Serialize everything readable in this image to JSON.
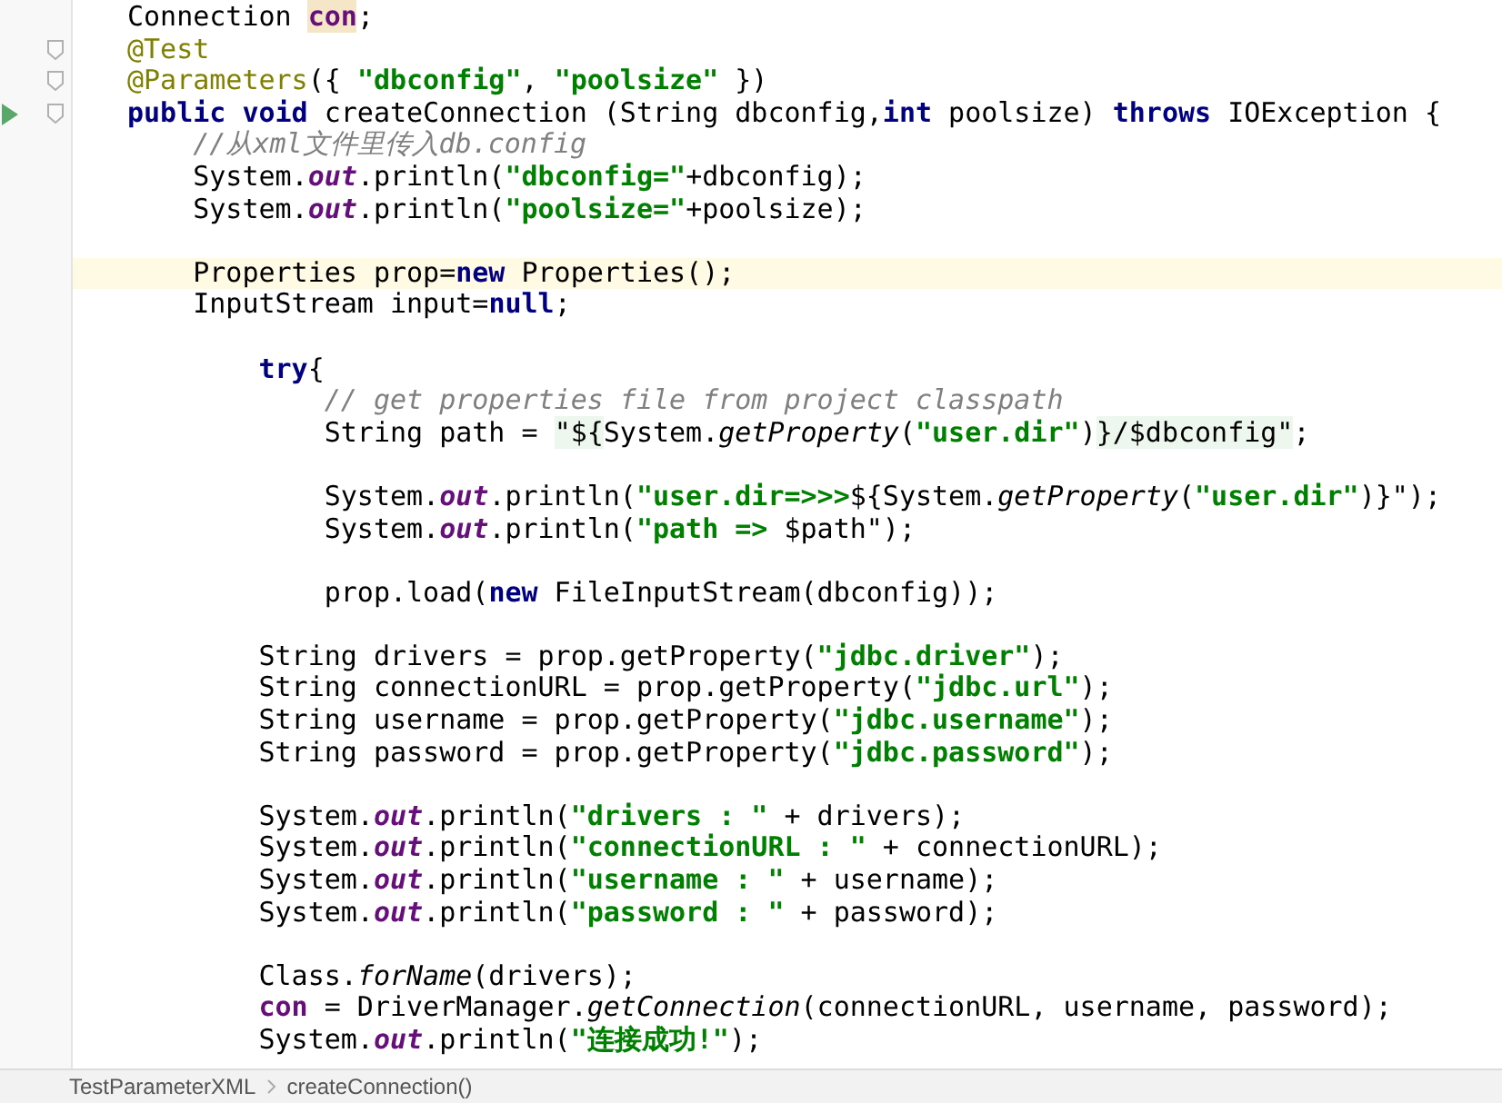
{
  "editor": {
    "lines": [
      {
        "current": false,
        "fold_marker": false,
        "run_marker": false,
        "tokens": [
          {
            "text": "Connection ",
            "kind": "plain"
          },
          {
            "text": "con",
            "kind": "usage"
          },
          {
            "text": ";",
            "kind": "plain"
          }
        ]
      },
      {
        "current": false,
        "fold_marker": true,
        "run_marker": false,
        "tokens": [
          {
            "text": "@Test",
            "kind": "annotation"
          }
        ]
      },
      {
        "current": false,
        "fold_marker": true,
        "run_marker": false,
        "tokens": [
          {
            "text": "@Parameters",
            "kind": "annotation"
          },
          {
            "text": "({ ",
            "kind": "plain"
          },
          {
            "text": "\"dbconfig\"",
            "kind": "string"
          },
          {
            "text": ", ",
            "kind": "plain"
          },
          {
            "text": "\"poolsize\"",
            "kind": "string"
          },
          {
            "text": " })",
            "kind": "plain"
          }
        ]
      },
      {
        "current": false,
        "fold_marker": true,
        "run_marker": true,
        "tokens": [
          {
            "text": "public void",
            "kind": "keyword"
          },
          {
            "text": " createConnection (String dbconfig,",
            "kind": "plain"
          },
          {
            "text": "int",
            "kind": "keyword"
          },
          {
            "text": " poolsize) ",
            "kind": "plain"
          },
          {
            "text": "throws",
            "kind": "keyword"
          },
          {
            "text": " IOException {",
            "kind": "plain"
          }
        ]
      },
      {
        "current": false,
        "fold_marker": false,
        "run_marker": false,
        "tokens": [
          {
            "text": "    //从xml文件里传入db.config",
            "kind": "comment"
          }
        ]
      },
      {
        "current": false,
        "fold_marker": false,
        "run_marker": false,
        "tokens": [
          {
            "text": "    System.",
            "kind": "plain"
          },
          {
            "text": "out",
            "kind": "field"
          },
          {
            "text": ".println(",
            "kind": "plain"
          },
          {
            "text": "\"dbconfig=\"",
            "kind": "string"
          },
          {
            "text": "+dbconfig);",
            "kind": "plain"
          }
        ]
      },
      {
        "current": false,
        "fold_marker": false,
        "run_marker": false,
        "tokens": [
          {
            "text": "    System.",
            "kind": "plain"
          },
          {
            "text": "out",
            "kind": "field"
          },
          {
            "text": ".println(",
            "kind": "plain"
          },
          {
            "text": "\"poolsize=\"",
            "kind": "string"
          },
          {
            "text": "+poolsize);",
            "kind": "plain"
          }
        ]
      },
      {
        "current": false,
        "fold_marker": false,
        "run_marker": false
      },
      {
        "current": true,
        "fold_marker": false,
        "run_marker": false,
        "tokens": [
          {
            "text": "    Properties prop=",
            "kind": "plain"
          },
          {
            "text": "new",
            "kind": "keyword"
          },
          {
            "text": " Properties();",
            "kind": "plain"
          }
        ]
      },
      {
        "current": false,
        "fold_marker": false,
        "run_marker": false,
        "tokens": [
          {
            "text": "    InputStream input=",
            "kind": "plain"
          },
          {
            "text": "null",
            "kind": "keyword"
          },
          {
            "text": ";",
            "kind": "plain"
          }
        ]
      },
      {
        "current": false,
        "fold_marker": false,
        "run_marker": false
      },
      {
        "current": false,
        "fold_marker": false,
        "run_marker": false,
        "tokens": [
          {
            "text": "        try",
            "kind": "keyword"
          },
          {
            "text": "{",
            "kind": "plain"
          }
        ]
      },
      {
        "current": false,
        "fold_marker": false,
        "run_marker": false,
        "tokens": [
          {
            "text": "            // get properties file from project classpath",
            "kind": "comment"
          }
        ]
      },
      {
        "current": false,
        "fold_marker": false,
        "run_marker": false,
        "tokens": [
          {
            "text": "            String path = ",
            "kind": "plain"
          },
          {
            "text": "\"${",
            "kind": "gstring"
          },
          {
            "text": "System.",
            "kind": "plain"
          },
          {
            "text": "getProperty",
            "kind": "static"
          },
          {
            "text": "(",
            "kind": "plain"
          },
          {
            "text": "\"user.dir\"",
            "kind": "string"
          },
          {
            "text": ")",
            "kind": "plain"
          },
          {
            "text": "}/$dbconfig\"",
            "kind": "gstring"
          },
          {
            "text": ";",
            "kind": "plain"
          }
        ]
      },
      {
        "current": false,
        "fold_marker": false,
        "run_marker": false
      },
      {
        "current": false,
        "fold_marker": false,
        "run_marker": false,
        "tokens": [
          {
            "text": "            System.",
            "kind": "plain"
          },
          {
            "text": "out",
            "kind": "field"
          },
          {
            "text": ".println(",
            "kind": "plain"
          },
          {
            "text": "\"user.dir=>>>",
            "kind": "string"
          },
          {
            "text": "${System.",
            "kind": "plain"
          },
          {
            "text": "getProperty",
            "kind": "static"
          },
          {
            "text": "(",
            "kind": "plain"
          },
          {
            "text": "\"user.dir\"",
            "kind": "string"
          },
          {
            "text": ")}\");",
            "kind": "plain"
          }
        ]
      },
      {
        "current": false,
        "fold_marker": false,
        "run_marker": false,
        "tokens": [
          {
            "text": "            System.",
            "kind": "plain"
          },
          {
            "text": "out",
            "kind": "field"
          },
          {
            "text": ".println(",
            "kind": "plain"
          },
          {
            "text": "\"path => ",
            "kind": "string"
          },
          {
            "text": "$path\");",
            "kind": "plain"
          }
        ]
      },
      {
        "current": false,
        "fold_marker": false,
        "run_marker": false
      },
      {
        "current": false,
        "fold_marker": false,
        "run_marker": false,
        "tokens": [
          {
            "text": "            prop.load(",
            "kind": "plain"
          },
          {
            "text": "new",
            "kind": "keyword"
          },
          {
            "text": " FileInputStream(dbconfig));",
            "kind": "plain"
          }
        ]
      },
      {
        "current": false,
        "fold_marker": false,
        "run_marker": false
      },
      {
        "current": false,
        "fold_marker": false,
        "run_marker": false,
        "tokens": [
          {
            "text": "        String drivers = prop.getProperty(",
            "kind": "plain"
          },
          {
            "text": "\"jdbc.driver\"",
            "kind": "string"
          },
          {
            "text": ");",
            "kind": "plain"
          }
        ]
      },
      {
        "current": false,
        "fold_marker": false,
        "run_marker": false,
        "tokens": [
          {
            "text": "        String connectionURL = prop.getProperty(",
            "kind": "plain"
          },
          {
            "text": "\"jdbc.url\"",
            "kind": "string"
          },
          {
            "text": ");",
            "kind": "plain"
          }
        ]
      },
      {
        "current": false,
        "fold_marker": false,
        "run_marker": false,
        "tokens": [
          {
            "text": "        String username = prop.getProperty(",
            "kind": "plain"
          },
          {
            "text": "\"jdbc.username\"",
            "kind": "string"
          },
          {
            "text": ");",
            "kind": "plain"
          }
        ]
      },
      {
        "current": false,
        "fold_marker": false,
        "run_marker": false,
        "tokens": [
          {
            "text": "        String password = prop.getProperty(",
            "kind": "plain"
          },
          {
            "text": "\"jdbc.password\"",
            "kind": "string"
          },
          {
            "text": ");",
            "kind": "plain"
          }
        ]
      },
      {
        "current": false,
        "fold_marker": false,
        "run_marker": false
      },
      {
        "current": false,
        "fold_marker": false,
        "run_marker": false,
        "tokens": [
          {
            "text": "        System.",
            "kind": "plain"
          },
          {
            "text": "out",
            "kind": "field"
          },
          {
            "text": ".println(",
            "kind": "plain"
          },
          {
            "text": "\"drivers : \"",
            "kind": "string"
          },
          {
            "text": " + drivers);",
            "kind": "plain"
          }
        ]
      },
      {
        "current": false,
        "fold_marker": false,
        "run_marker": false,
        "tokens": [
          {
            "text": "        System.",
            "kind": "plain"
          },
          {
            "text": "out",
            "kind": "field"
          },
          {
            "text": ".println(",
            "kind": "plain"
          },
          {
            "text": "\"connectionURL : \"",
            "kind": "string"
          },
          {
            "text": " + connectionURL);",
            "kind": "plain"
          }
        ]
      },
      {
        "current": false,
        "fold_marker": false,
        "run_marker": false,
        "tokens": [
          {
            "text": "        System.",
            "kind": "plain"
          },
          {
            "text": "out",
            "kind": "field"
          },
          {
            "text": ".println(",
            "kind": "plain"
          },
          {
            "text": "\"username : \"",
            "kind": "string"
          },
          {
            "text": " + username);",
            "kind": "plain"
          }
        ]
      },
      {
        "current": false,
        "fold_marker": false,
        "run_marker": false,
        "tokens": [
          {
            "text": "        System.",
            "kind": "plain"
          },
          {
            "text": "out",
            "kind": "field"
          },
          {
            "text": ".println(",
            "kind": "plain"
          },
          {
            "text": "\"password : \"",
            "kind": "string"
          },
          {
            "text": " + password);",
            "kind": "plain"
          }
        ]
      },
      {
        "current": false,
        "fold_marker": false,
        "run_marker": false
      },
      {
        "current": false,
        "fold_marker": false,
        "run_marker": false,
        "tokens": [
          {
            "text": "        Class.",
            "kind": "plain"
          },
          {
            "text": "forName",
            "kind": "static"
          },
          {
            "text": "(drivers);",
            "kind": "plain"
          }
        ]
      },
      {
        "current": false,
        "fold_marker": false,
        "run_marker": false,
        "tokens": [
          {
            "text": "        con",
            "kind": "ref"
          },
          {
            "text": " = DriverManager.",
            "kind": "plain"
          },
          {
            "text": "getConnection",
            "kind": "static"
          },
          {
            "text": "(connectionURL, username, password);",
            "kind": "plain"
          }
        ]
      },
      {
        "current": false,
        "fold_marker": false,
        "run_marker": false,
        "tokens": [
          {
            "text": "        System.",
            "kind": "plain"
          },
          {
            "text": "out",
            "kind": "field"
          },
          {
            "text": ".println(",
            "kind": "plain"
          },
          {
            "text": "\"连接成功!\"",
            "kind": "string"
          },
          {
            "text": ");",
            "kind": "plain"
          }
        ]
      }
    ]
  },
  "breadcrumbs": [
    {
      "label": "TestParameterXML"
    },
    {
      "label": "createConnection()"
    }
  ]
}
